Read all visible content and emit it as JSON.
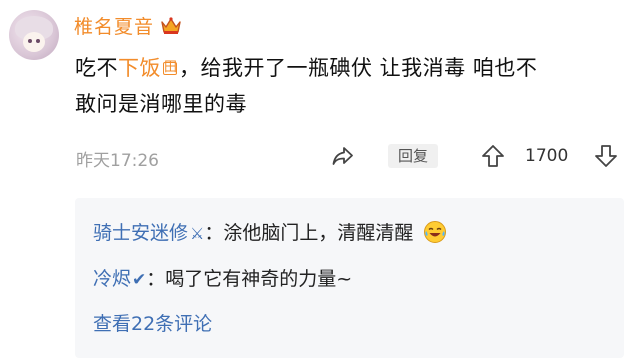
{
  "comment": {
    "author": "椎名夏音",
    "text_before_link": "吃不",
    "link_text": "下饭",
    "link_icon": "田",
    "text_line1_rest": "，给我开了一瓶碘伏 让我消毒 咱也不",
    "text_line2": "敢问是消哪里的毒",
    "timestamp": "昨天17:26",
    "reply_label": "回复",
    "vote_count": "1700"
  },
  "replies": [
    {
      "name": "骑士安迷修",
      "badge": "⚔",
      "separator": "：",
      "text": "涂他脑门上，清醒清醒",
      "emoji": "laughing-crying-emoji"
    },
    {
      "name": "冷烬",
      "badge": "✔",
      "separator": "：",
      "text": "喝了它有神奇的力量~"
    }
  ],
  "view_more": "查看22条评论",
  "colors": {
    "username": "#f28c2b",
    "reply_name": "#3f6fb4",
    "reply_bg": "#f6f7f9",
    "timestamp": "#a0a0a0"
  }
}
